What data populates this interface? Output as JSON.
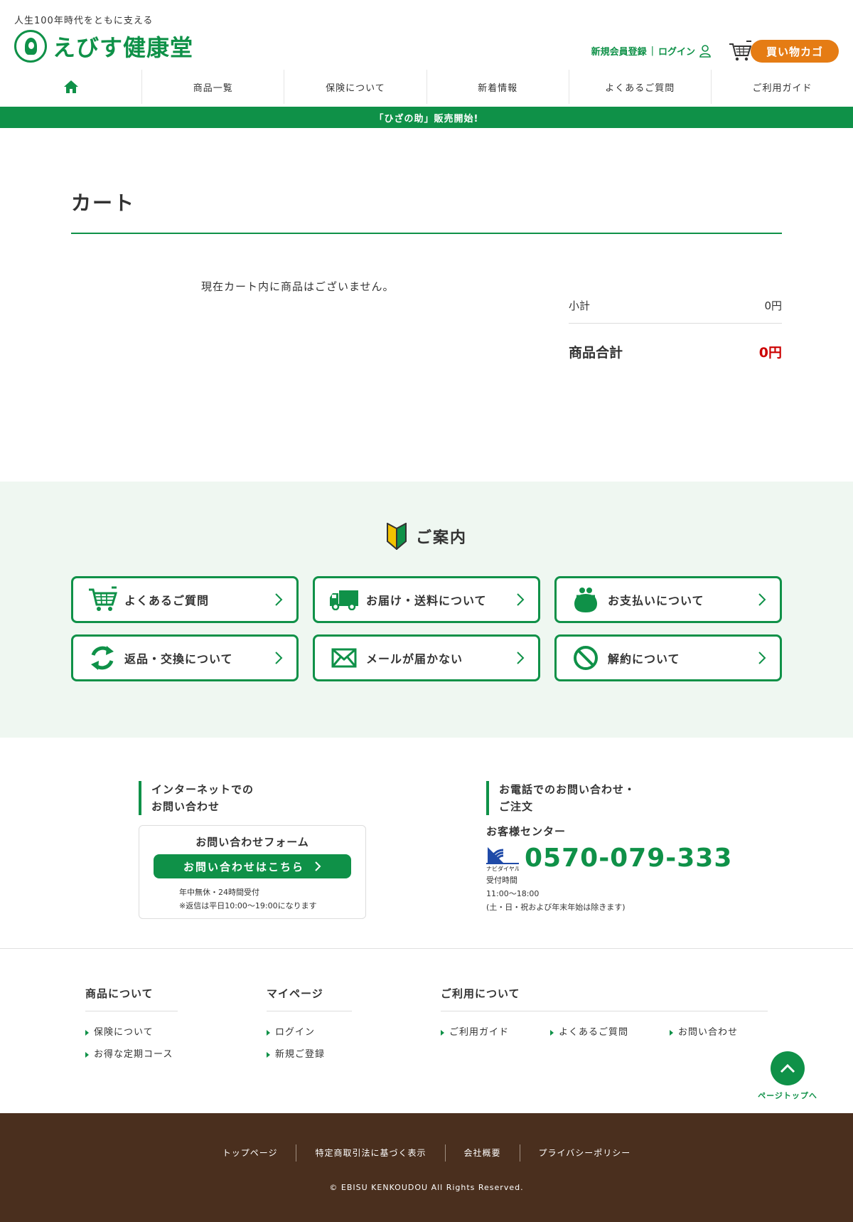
{
  "header": {
    "tagline": "人生100年時代をともに支える",
    "logo_text": "えびす健康堂",
    "register_link": "新規会員登録",
    "separator": "|",
    "login_link": "ログイン",
    "cart_button": "買い物カゴ"
  },
  "nav": {
    "items": [
      "商品一覧",
      "保険について",
      "新着情報",
      "よくあるご質問",
      "ご利用ガイド"
    ]
  },
  "banner": "「ひざの助」販売開始!",
  "cart": {
    "title": "カート",
    "empty_message": "現在カート内に商品はございません。",
    "subtotal_label": "小計",
    "subtotal_value": "0円",
    "total_label": "商品合計",
    "total_value": "0円"
  },
  "guide": {
    "heading": "ご案内",
    "buttons": [
      {
        "label": "よくあるご質問",
        "icon": "cart-icon"
      },
      {
        "label": "お届け・送料について",
        "icon": "truck-icon"
      },
      {
        "label": "お支払いについて",
        "icon": "purse-icon"
      },
      {
        "label": "返品・交換について",
        "icon": "recycle-icon"
      },
      {
        "label": "メールが届かない",
        "icon": "mail-icon"
      },
      {
        "label": "解約について",
        "icon": "prohibited-icon"
      }
    ]
  },
  "contact": {
    "internet_heading_1": "インターネットでの",
    "internet_heading_2": "お問い合わせ",
    "form_title": "お問い合わせフォーム",
    "form_button": "お問い合わせはこちら",
    "form_note_1": "年中無休・24時間受付",
    "form_note_2": "※返信は平日10:00〜19:00になります",
    "phone_heading_1": "お電話でのお問い合わせ・",
    "phone_heading_2": "ご注文",
    "center_label": "お客様センター",
    "navi_label": "ナビダイヤル",
    "phone_number": "0570-079-333",
    "hours_label": "受付時間",
    "hours_time": "11:00〜18:00",
    "hours_note": "(土・日・祝および年末年始は除きます)"
  },
  "footer": {
    "col1_title": "商品について",
    "col1_links": [
      "保険について",
      "お得な定期コース"
    ],
    "col2_title": "マイページ",
    "col2_links": [
      "ログイン",
      "新規ご登録"
    ],
    "col3_title": "ご利用について",
    "col3_links": [
      "ご利用ガイド",
      "よくあるご質問",
      "お問い合わせ"
    ],
    "pagetop_label": "ページトップへ",
    "bottom_links": [
      "トップページ",
      "特定商取引法に基づく表示",
      "会社概要",
      "プライバシーポリシー"
    ],
    "copyright": "© EBISU KENKOUDOU All Rights Reserved."
  },
  "colors": {
    "brand_green": "#0f9148",
    "cart_orange": "#e57c14",
    "total_red": "#cc0000",
    "footer_brown": "#4a2f1e",
    "guide_bg": "#eff7f1"
  }
}
